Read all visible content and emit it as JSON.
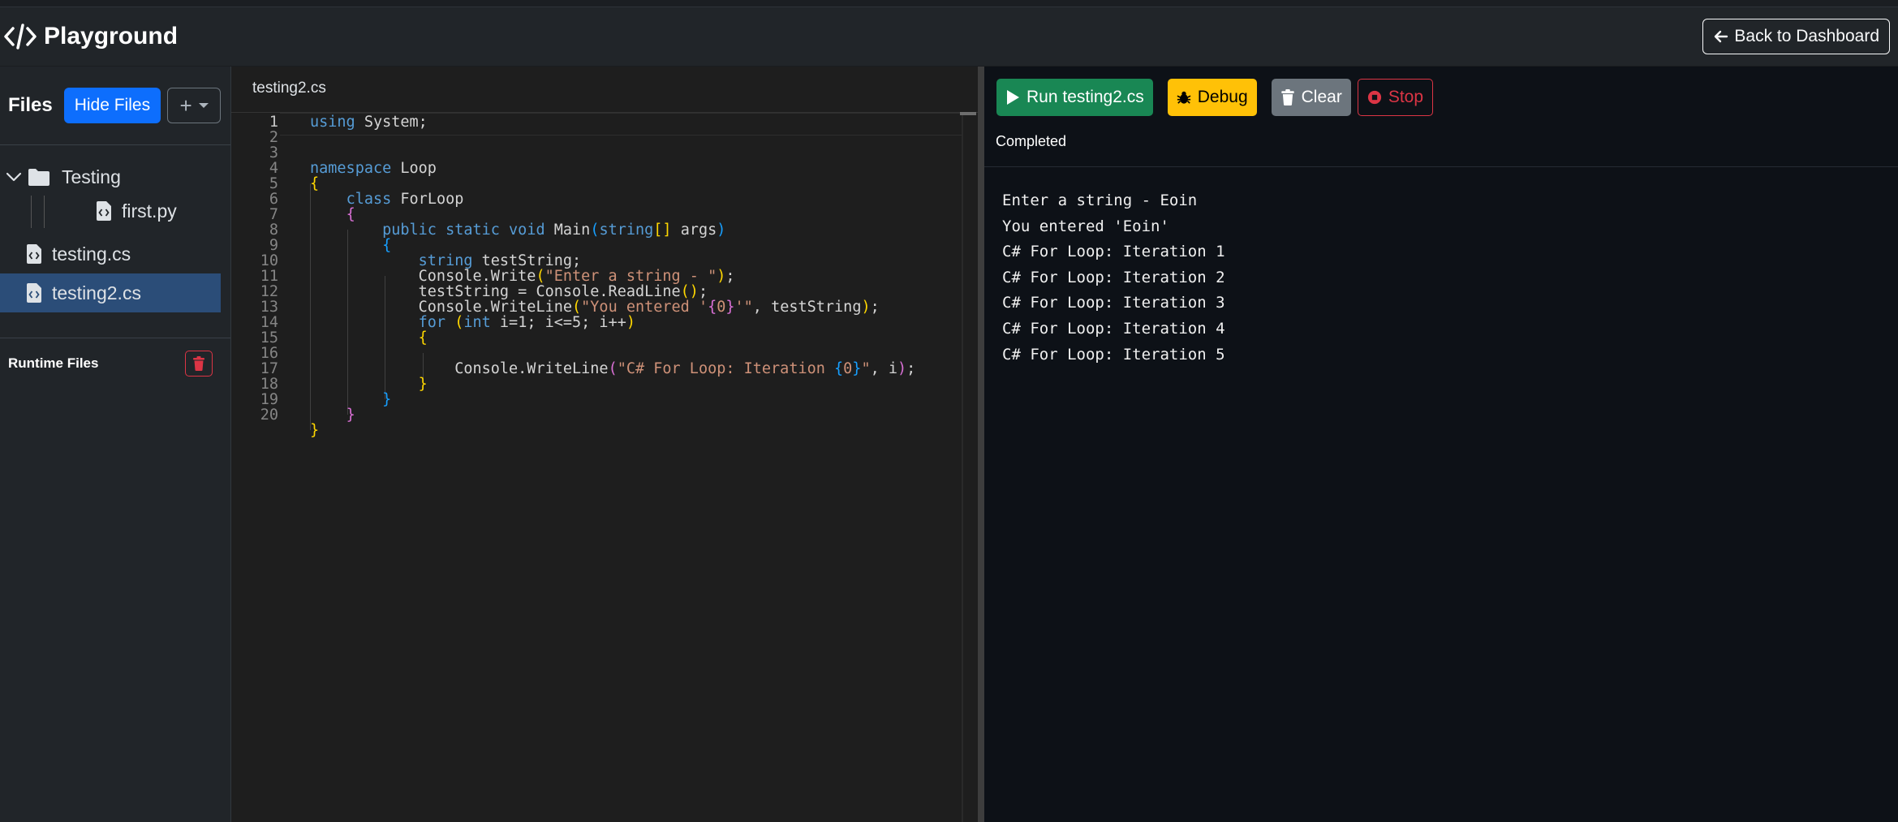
{
  "header": {
    "brand": "Playground",
    "back_label": "Back to Dashboard"
  },
  "sidebar": {
    "files_title": "Files",
    "hide_label": "Hide Files",
    "add_label": "+",
    "tree": {
      "folder": "Testing",
      "folder_children": [
        "first.py"
      ],
      "files": [
        "testing.cs",
        "testing2.cs"
      ],
      "active_file": "testing2.cs"
    },
    "runtime_title": "Runtime Files"
  },
  "editor": {
    "tab": "testing2.cs",
    "line_numbers": [
      "1",
      "2",
      "3",
      "4",
      "5",
      "6",
      "7",
      "8",
      "9",
      "10",
      "11",
      "12",
      "13",
      "14",
      "15",
      "16",
      "17",
      "18",
      "19",
      "20"
    ]
  },
  "output": {
    "run_label": "Run testing2.cs",
    "debug_label": "Debug",
    "clear_label": "Clear",
    "stop_label": "Stop",
    "status": "Completed",
    "lines": [
      "Enter a string - Eoin",
      "You entered 'Eoin'",
      "C# For Loop: Iteration 1",
      "C# For Loop: Iteration 2",
      "C# For Loop: Iteration 3",
      "C# For Loop: Iteration 4",
      "C# For Loop: Iteration 5"
    ]
  },
  "colors": {
    "accent_blue": "#0d6efd",
    "run_green": "#198754",
    "debug_yellow": "#ffc107",
    "clear_gray": "#6c757d",
    "stop_red": "#dc3545",
    "active_file_bg": "#2b4d78"
  },
  "icons": {
    "brand": "code-icon",
    "back": "arrow-left-icon",
    "folder": "folder-icon",
    "file": "file-code-icon",
    "run": "play-icon",
    "debug": "bug-icon",
    "clear": "trash-icon",
    "stop": "stop-circle-icon"
  }
}
